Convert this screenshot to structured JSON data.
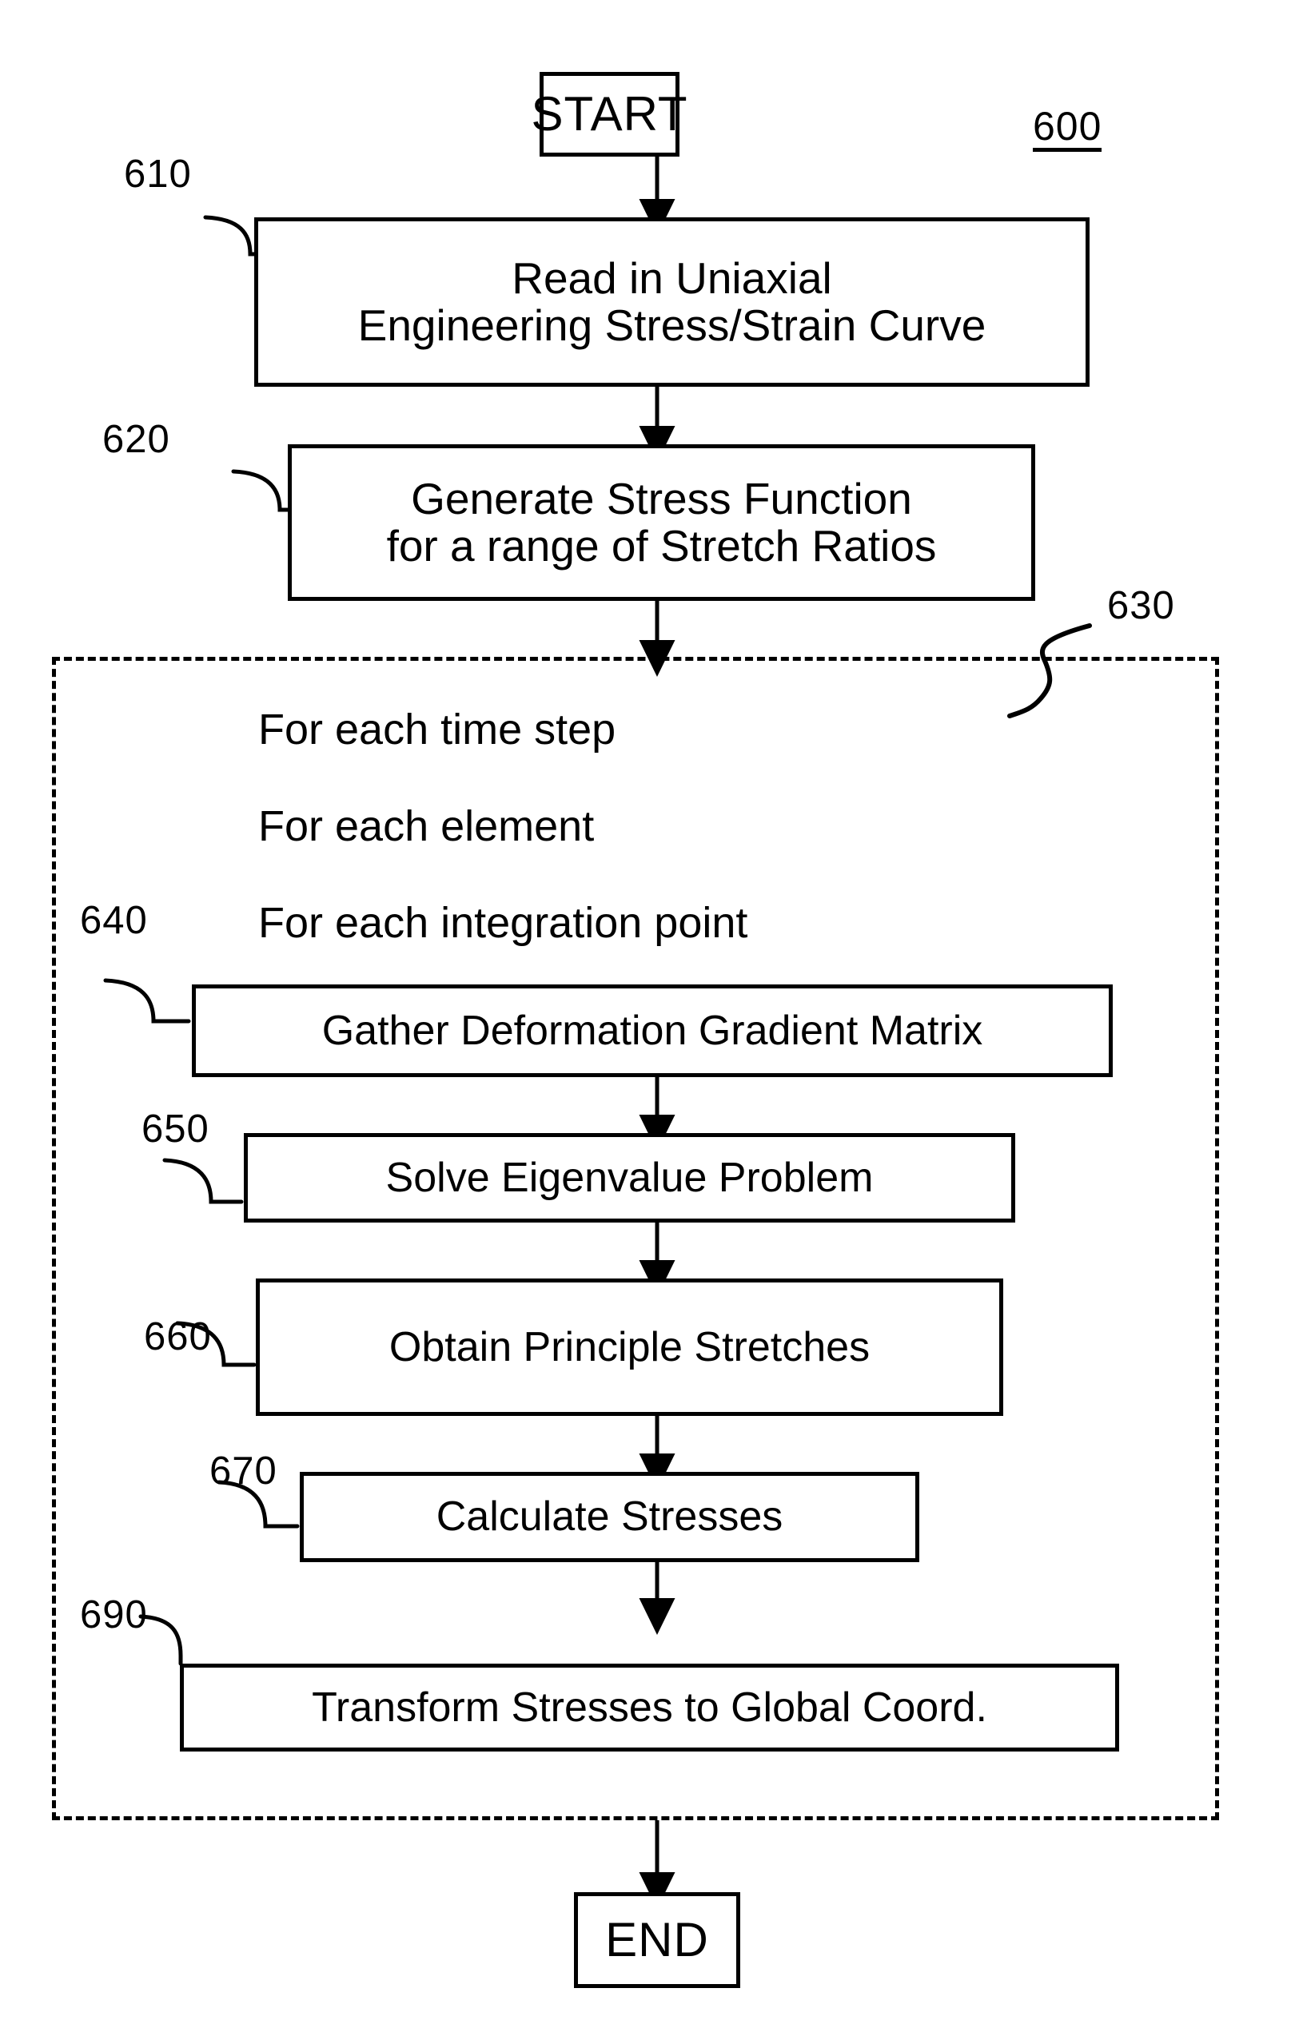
{
  "figure": {
    "number": "600",
    "type": "flowchart"
  },
  "nodes": {
    "start": {
      "ref": "",
      "label": "START"
    },
    "read_curve": {
      "ref": "610",
      "line1": "Read in Uniaxial",
      "line2": "Engineering Stress/Strain Curve"
    },
    "stress_function": {
      "ref": "620",
      "line1": "Generate Stress Function",
      "line2": "for a range of Stretch Ratios"
    },
    "loop_block": {
      "ref": "630"
    },
    "gather": {
      "ref": "640",
      "label": "Gather Deformation Gradient Matrix"
    },
    "eigen": {
      "ref": "650",
      "label": "Solve Eigenvalue Problem"
    },
    "stretches": {
      "ref": "660",
      "label": "Obtain Principle Stretches"
    },
    "stresses": {
      "ref": "670",
      "label": "Calculate Stresses"
    },
    "transform": {
      "ref": "690",
      "label": "Transform Stresses to Global Coord."
    },
    "end": {
      "ref": "",
      "label": "END"
    }
  },
  "loop_labels": {
    "time_step": "For each time step",
    "element": "For each element",
    "integration_point": "For each integration point"
  },
  "colors": {
    "stroke": "#000000",
    "background": "#ffffff"
  }
}
